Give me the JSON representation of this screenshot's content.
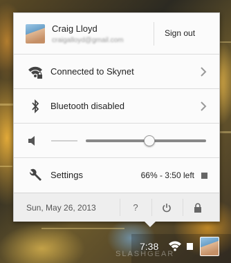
{
  "user": {
    "name": "Craig Lloyd",
    "email": "craigalloyd@gmail.com",
    "sign_out_label": "Sign out"
  },
  "network": {
    "label": "Connected to Skynet",
    "icon": "wifi-locked-icon"
  },
  "bluetooth": {
    "label": "Bluetooth disabled",
    "icon": "bluetooth-icon"
  },
  "volume": {
    "icon": "speaker-icon",
    "level": 0.53
  },
  "settings": {
    "label": "Settings",
    "icon": "wrench-icon",
    "battery_text": "66% - 3:50 left"
  },
  "footer": {
    "date": "Sun, May 26, 2013",
    "help_label": "?",
    "power_icon": "power-icon",
    "lock_icon": "lock-icon"
  },
  "shelf": {
    "time": "7:38"
  },
  "watermark": "SLASHGEAR",
  "colors": {
    "panel": "#f4f4f4",
    "text": "#222222",
    "muted": "#666666"
  }
}
